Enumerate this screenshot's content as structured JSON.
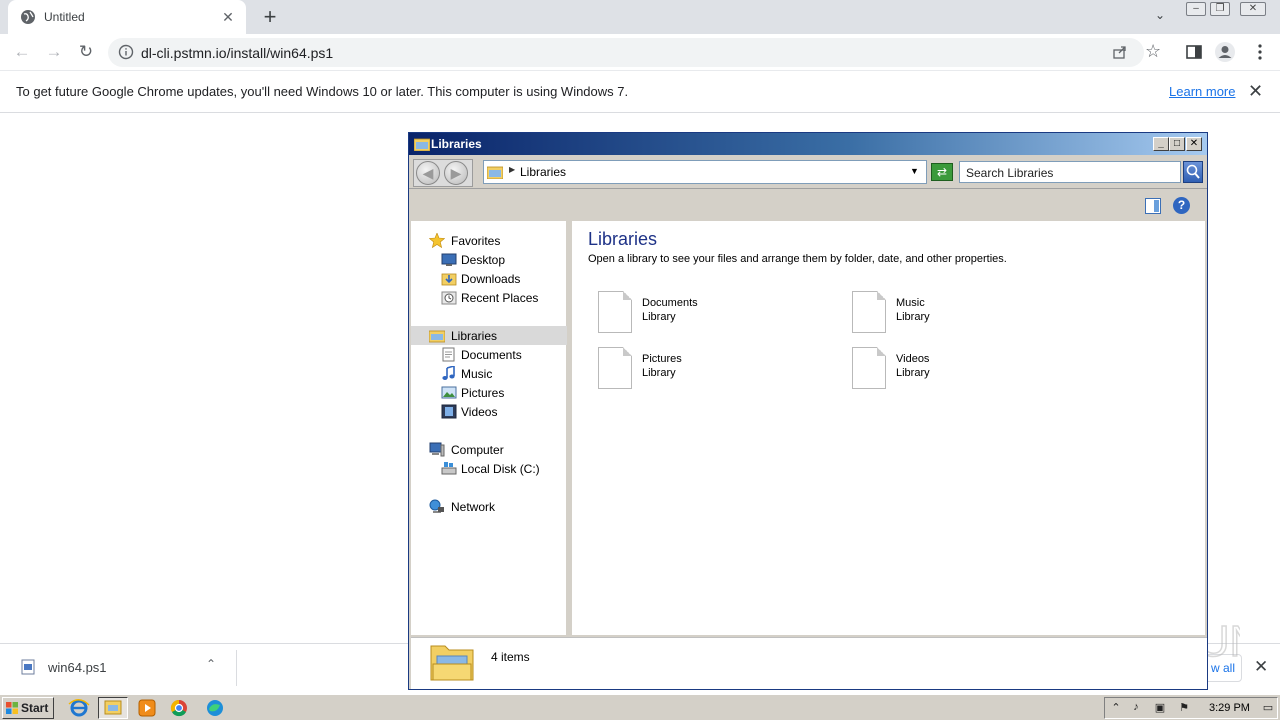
{
  "browser": {
    "tab": {
      "title": "Untitled"
    },
    "address_url": "dl-cli.pstmn.io/install/win64.ps1",
    "infobar": {
      "message": "To get future Google Chrome updates, you'll need Windows 10 or later. This computer is using Windows 7.",
      "link": "Learn more"
    },
    "download_shelf": {
      "file_name": "win64.ps1",
      "show_all": "w all"
    }
  },
  "explorer": {
    "title": "Libraries",
    "address": "Libraries",
    "search_placeholder": "Search Libraries",
    "nav": {
      "favorites": "Favorites",
      "desktop": "Desktop",
      "downloads": "Downloads",
      "recent_places": "Recent Places",
      "libraries": "Libraries",
      "documents": "Documents",
      "music": "Music",
      "pictures": "Pictures",
      "videos": "Videos",
      "computer": "Computer",
      "local_disk": "Local Disk (C:)",
      "network": "Network"
    },
    "content": {
      "heading": "Libraries",
      "description": "Open a library to see your files and arrange them by folder, date, and other properties.",
      "items": [
        {
          "name": "Documents",
          "type": "Library"
        },
        {
          "name": "Music",
          "type": "Library"
        },
        {
          "name": "Pictures",
          "type": "Library"
        },
        {
          "name": "Videos",
          "type": "Library"
        }
      ]
    },
    "status": "4 items"
  },
  "taskbar": {
    "start": "Start",
    "clock": "3:29 PM"
  },
  "watermark": "ANY RUN"
}
